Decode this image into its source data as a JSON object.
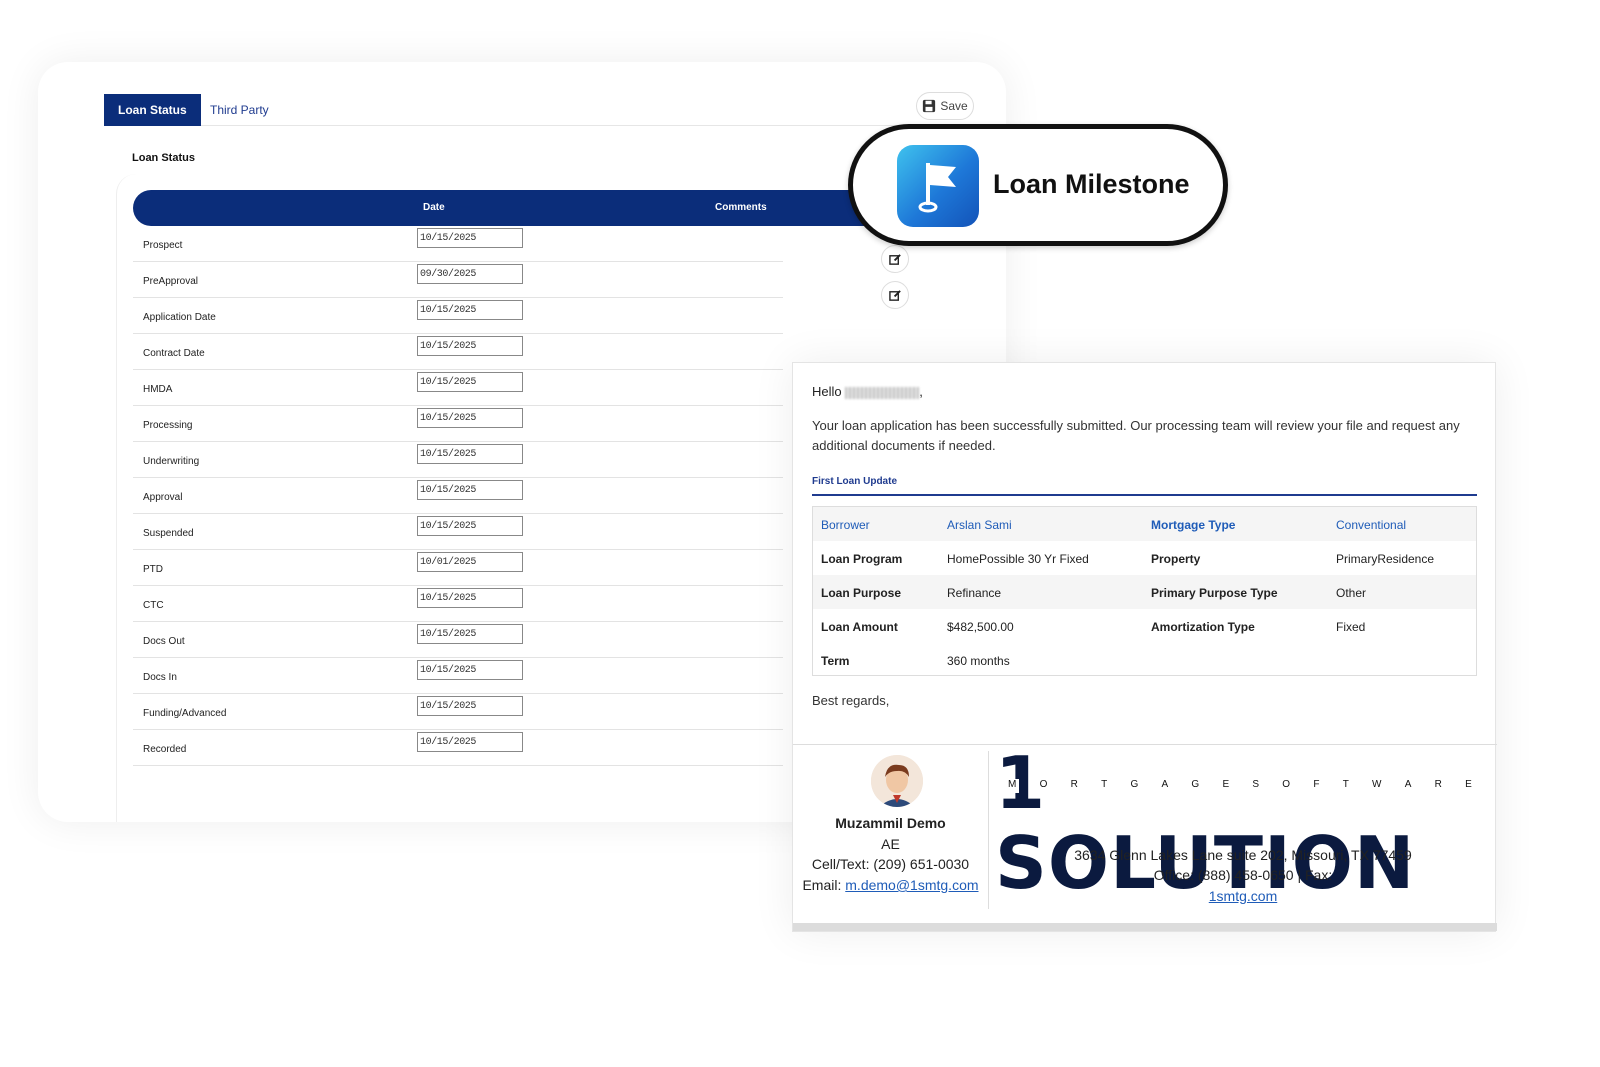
{
  "tabs": {
    "active_label": "Loan Status",
    "inactive_label": "Third Party"
  },
  "toolbar": {
    "save_label": "Save"
  },
  "section_title": "Loan Status",
  "table": {
    "col_date": "Date",
    "col_comments": "Comments",
    "rows": [
      {
        "label": "Prospect",
        "date": "10/15/2025"
      },
      {
        "label": "PreApproval",
        "date": "09/30/2025"
      },
      {
        "label": "Application Date",
        "date": "10/15/2025"
      },
      {
        "label": "Contract Date",
        "date": "10/15/2025"
      },
      {
        "label": "HMDA",
        "date": "10/15/2025"
      },
      {
        "label": "Processing",
        "date": "10/15/2025"
      },
      {
        "label": "Underwriting",
        "date": "10/15/2025"
      },
      {
        "label": "Approval",
        "date": "10/15/2025"
      },
      {
        "label": "Suspended",
        "date": "10/15/2025"
      },
      {
        "label": "PTD",
        "date": "10/01/2025"
      },
      {
        "label": "CTC",
        "date": "10/15/2025"
      },
      {
        "label": "Docs Out",
        "date": "10/15/2025"
      },
      {
        "label": "Docs In",
        "date": "10/15/2025"
      },
      {
        "label": "Funding/Advanced",
        "date": "10/15/2025"
      },
      {
        "label": "Recorded",
        "date": "10/15/2025"
      }
    ]
  },
  "milestone": {
    "title": "Loan Milestone",
    "icon": "flag-icon",
    "accent": "#1e78d8"
  },
  "email": {
    "greeting": "Hello",
    "greeting_suffix": ",",
    "intro": "Your loan application has been successfully submitted. Our processing team will review your file and request any additional documents if needed.",
    "update_title": "First Loan Update",
    "info": {
      "borrower_label": "Borrower",
      "borrower": "Arslan Sami",
      "mortgage_type_label": "Mortgage Type",
      "mortgage_type": "Conventional",
      "loan_program_label": "Loan Program",
      "loan_program": "HomePossible 30 Yr Fixed",
      "property_label": "Property",
      "property": "PrimaryResidence",
      "loan_purpose_label": "Loan Purpose",
      "loan_purpose": "Refinance",
      "primary_purpose_type_label": "Primary Purpose Type",
      "primary_purpose_type": "Other",
      "loan_amount_label": "Loan Amount",
      "loan_amount": "$482,500.00",
      "amortization_type_label": "Amortization Type",
      "amortization_type": "Fixed",
      "term_label": "Term",
      "term": "360 months"
    },
    "regards": "Best regards,",
    "signature": {
      "name": "Muzammil Demo",
      "role": "AE",
      "cell": "Cell/Text: (209) 651-0030",
      "email_label": "Email:",
      "email": "m.demo@1smtg.com"
    },
    "company": {
      "logo_main": "1 SOLUTION",
      "logo_sub": [
        "M",
        "O",
        "R",
        "T",
        "G",
        "A",
        "G",
        "E",
        "S",
        "O",
        "F",
        "T",
        "W",
        "A",
        "R",
        "E"
      ],
      "address": "3634 Glenn Lakes Lane suite 202, Missouri, TX 77459",
      "office": "Office: (888) 458-0650 | Fax:",
      "website": "1smtg.com"
    }
  },
  "colors": {
    "navy": "#0b2d7a",
    "link": "#1f5cb8"
  }
}
